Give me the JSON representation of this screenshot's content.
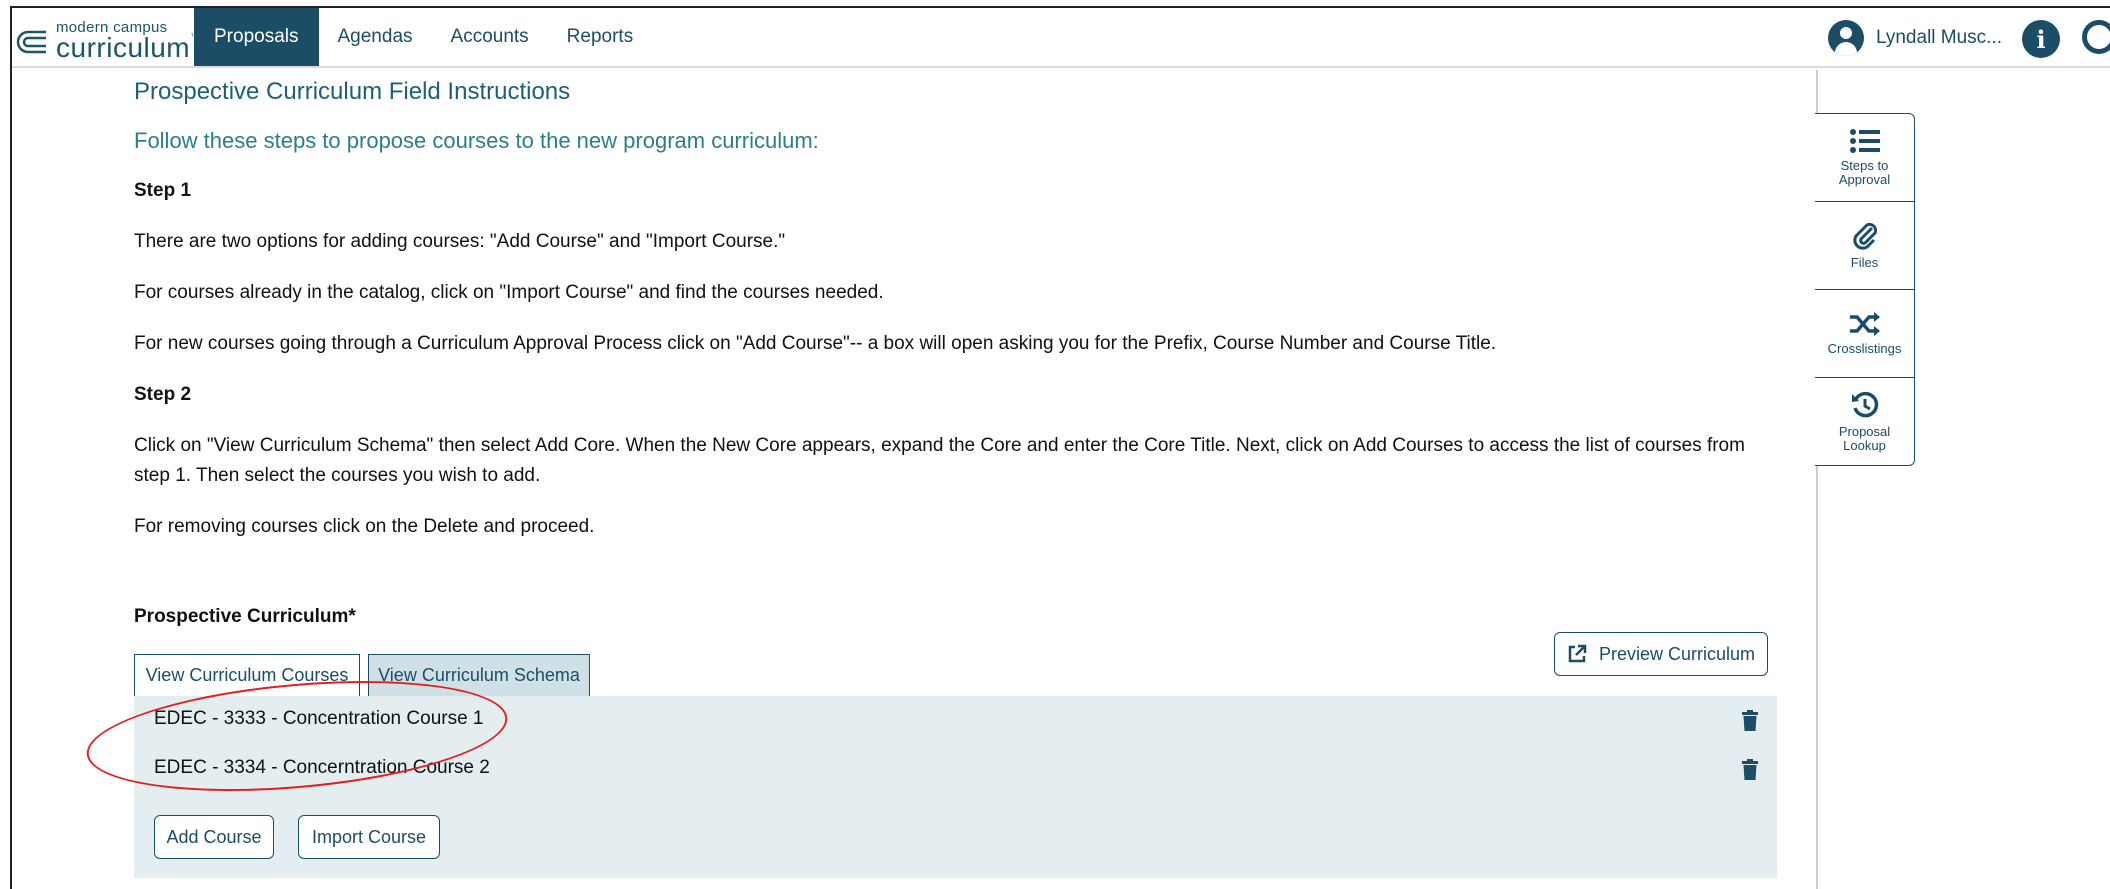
{
  "app": {
    "logo_small": "modern campus",
    "logo_big": "curriculum"
  },
  "nav": {
    "items": [
      "Proposals",
      "Agendas",
      "Accounts",
      "Reports"
    ],
    "active": "Proposals"
  },
  "user": {
    "name": "Lyndall Musc..."
  },
  "content": {
    "title": "Prospective Curriculum Field Instructions",
    "subtitle": "Follow these steps to propose courses to the new program curriculum:",
    "step1_heading": "Step 1",
    "step1_p1": "There are two options for adding courses: \"Add Course\" and \"Import Course.\"",
    "step1_p2": "For courses already in the catalog, click on \"Import Course\" and find the courses needed.",
    "step1_p3": "For new courses going through a Curriculum Approval Process click on \"Add Course\"-- a box will open asking you for the Prefix, Course Number and Course Title.",
    "step2_heading": "Step 2",
    "step2_p1": "Click on \"View Curriculum Schema\" then select Add Core. When the New Core appears, expand the Core and enter the Core Title. Next, click on Add Courses to access the list of courses from step 1. Then select the courses you wish to add.",
    "step2_p2": "For removing courses click on the Delete and proceed."
  },
  "curriculum": {
    "label": "Prospective Curriculum*",
    "tab_courses": "View Curriculum Courses",
    "tab_schema": "View Curriculum Schema",
    "preview_label": "Preview Curriculum",
    "courses": [
      "EDEC - 3333 - Concentration Course 1",
      "EDEC - 3334 - Concerntration Course 2"
    ],
    "add_course": "Add Course",
    "import_course": "Import Course"
  },
  "rail": {
    "steps_to_approval": "Steps to Approval",
    "files": "Files",
    "crosslistings": "Crosslistings",
    "proposal_lookup": "Proposal Lookup"
  },
  "colors": {
    "brand": "#1b4d66",
    "title": "#1d5f74",
    "subtitle": "#2b7f88",
    "course_area_bg": "#e4edf0",
    "highlight": "#e02020"
  }
}
